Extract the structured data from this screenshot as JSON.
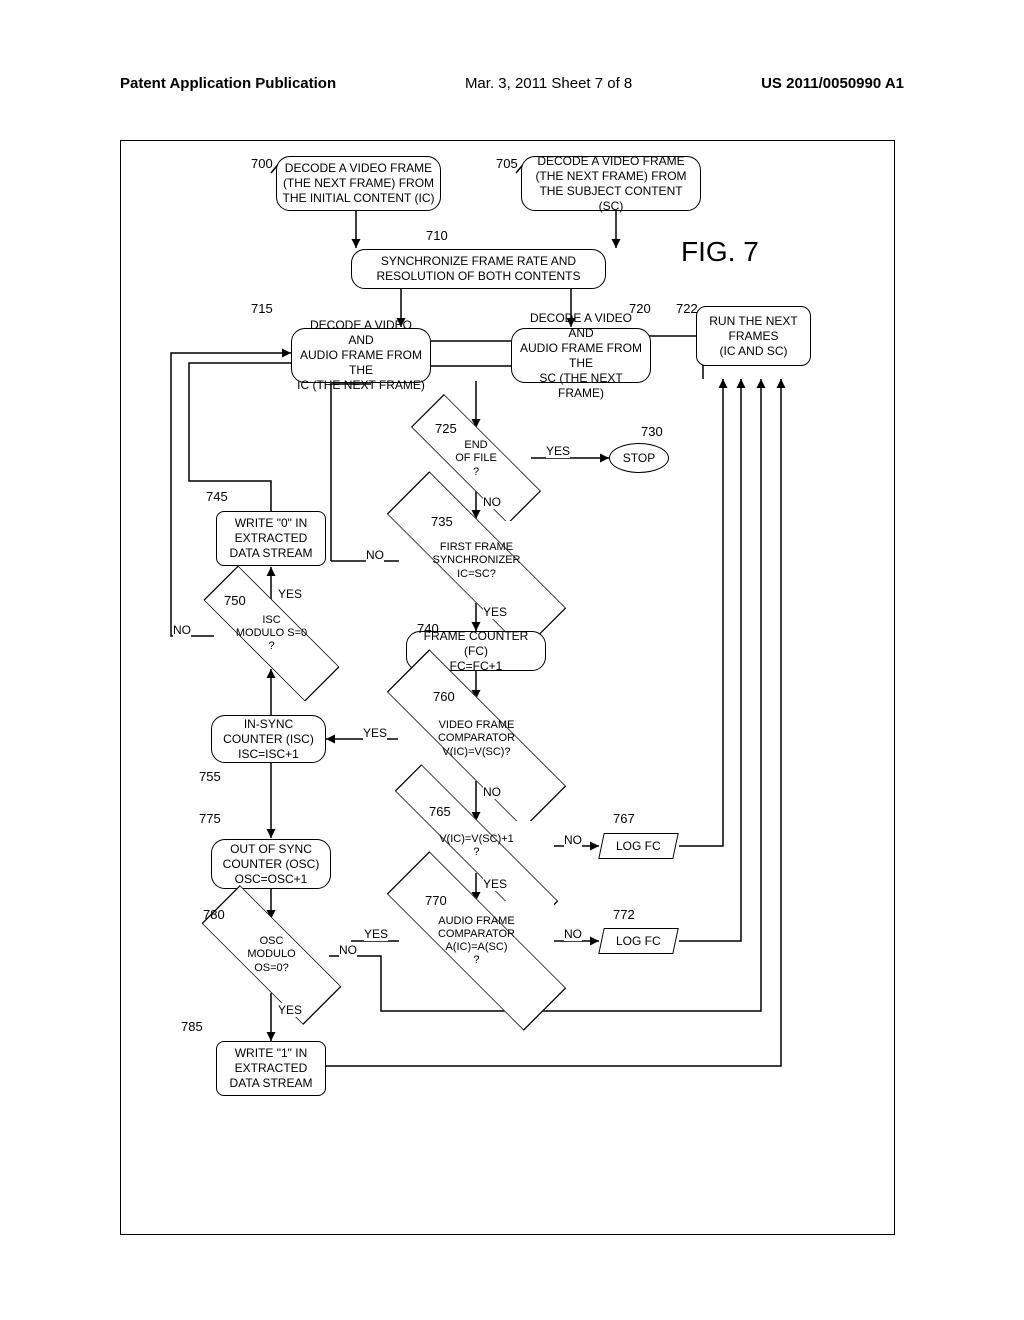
{
  "header": {
    "left": "Patent Application Publication",
    "center": "Mar. 3, 2011  Sheet 7 of 8",
    "right": "US 2011/0050990 A1"
  },
  "figure_title": "FIG. 7",
  "boxes": {
    "b700": "DECODE A VIDEO FRAME\n(THE NEXT FRAME) FROM\nTHE INITIAL CONTENT (IC)",
    "b705": "DECODE A VIDEO FRAME\n(THE NEXT FRAME) FROM\nTHE SUBJECT CONTENT (SC)",
    "b710": "SYNCHRONIZE FRAME RATE AND\nRESOLUTION OF BOTH CONTENTS",
    "b715": "DECODE A VIDEO AND\nAUDIO FRAME FROM THE\nIC (THE NEXT FRAME)",
    "b720": "DECODE A VIDEO AND\nAUDIO FRAME FROM THE\nSC (THE NEXT FRAME)",
    "b722": "RUN THE NEXT\nFRAMES\n(IC AND SC)",
    "b740": "FRAME COUNTER (FC)\nFC=FC+1",
    "b745": "WRITE \"0\" IN\nEXTRACTED\nDATA STREAM",
    "b755": "IN-SYNC\nCOUNTER (ISC)\nISC=ISC+1",
    "b775": "OUT OF SYNC\nCOUNTER (OSC)\nOSC=OSC+1",
    "b785": "WRITE \"1\" IN\nEXTRACTED\nDATA STREAM",
    "b767": "LOG FC",
    "b772": "LOG FC"
  },
  "diamonds": {
    "d725": "END\nOF FILE\n?",
    "d735": "FIRST FRAME\nSYNCHRONIZER\nIC=SC?",
    "d750": "ISC\nMODULO S=0\n?",
    "d760": "VIDEO FRAME\nCOMPARATOR\nV(IC)=V(SC)?",
    "d765": "V(IC)=V(SC)+1\n?",
    "d770": "AUDIO FRAME\nCOMPARATOR\nA(IC)=A(SC)\n?",
    "d780": "OSC\nMODULO\nOS=0?"
  },
  "stop": "STOP",
  "labels": {
    "yes": "YES",
    "no": "NO"
  },
  "refs": {
    "r700": "700",
    "r705": "705",
    "r710": "710",
    "r715": "715",
    "r720": "720",
    "r722": "722",
    "r725": "725",
    "r730": "730",
    "r735": "735",
    "r740": "740",
    "r745": "745",
    "r750": "750",
    "r755": "755",
    "r760": "760",
    "r765": "765",
    "r767": "767",
    "r770": "770",
    "r772": "772",
    "r775": "775",
    "r780": "780",
    "r785": "785"
  }
}
